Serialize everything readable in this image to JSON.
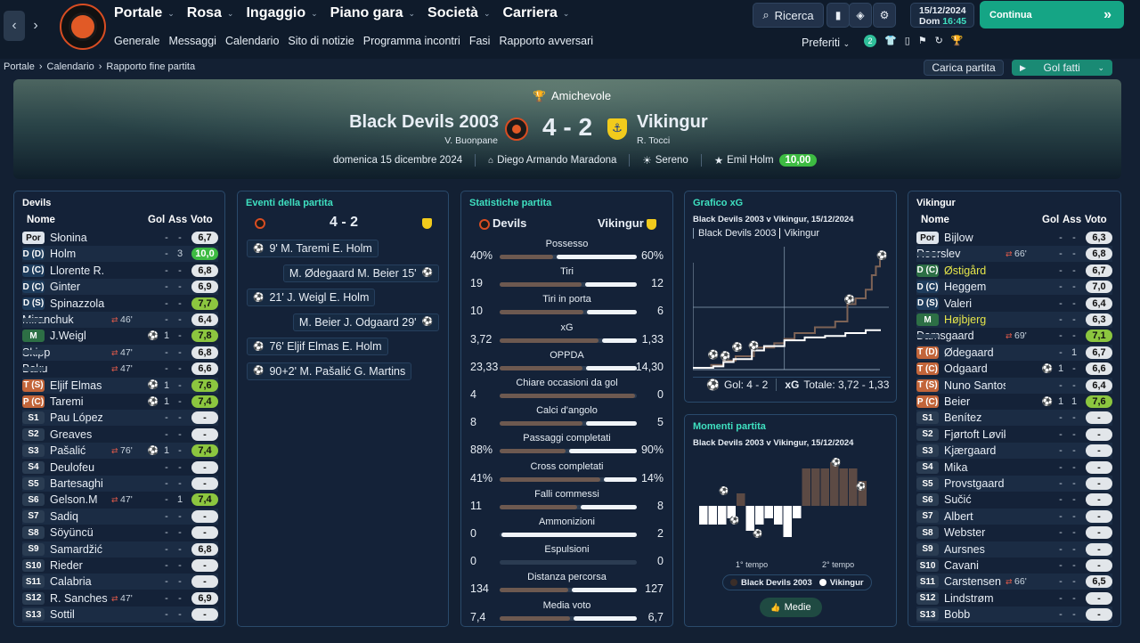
{
  "topbar": {
    "nav": [
      {
        "label": "Portale",
        "active": true
      },
      {
        "label": "Rosa",
        "active": false
      },
      {
        "label": "Ingaggio",
        "active": false
      },
      {
        "label": "Piano gara",
        "active": false
      },
      {
        "label": "Società",
        "active": false
      },
      {
        "label": "Carriera",
        "active": false
      }
    ],
    "subnav": [
      "Generale",
      "Messaggi",
      "Calendario",
      "Sito di notizie",
      "Programma incontri",
      "Fasi",
      "Rapporto avversari"
    ],
    "search_label": "Ricerca",
    "date": "15/12/2024",
    "day": "Dom",
    "time": "16:45",
    "continue_label": "Continua",
    "favorites_label": "Preferiti",
    "notification_count": "2"
  },
  "breadcrumb": [
    "Portale",
    "Calendario",
    "Rapporto fine partita"
  ],
  "actions": {
    "load_match": "Carica partita",
    "goals_filter": "Gol fatti"
  },
  "match": {
    "competition": "Amichevole",
    "home_team": "Black Devils 2003",
    "home_manager": "V. Buonpane",
    "away_team": "Vikingur",
    "away_manager": "R. Tocci",
    "score": "4 - 2",
    "date": "domenica 15 dicembre 2024",
    "stadium": "Diego Armando Maradona",
    "weather": "Sereno",
    "pom_name": "Emil Holm",
    "pom_rating": "10,00"
  },
  "home_lineup": {
    "title": "Devils",
    "headers": {
      "name": "Nome",
      "goals": "Gol",
      "assists": "Ass",
      "rating": "Voto"
    },
    "players": [
      {
        "pos": "Por",
        "type": "gk",
        "name": "Słonina",
        "sub": "",
        "ev": "",
        "g": "-",
        "a": "-",
        "r": "6,7",
        "rc": "r-g"
      },
      {
        "pos": "D (D)",
        "type": "d",
        "name": "Holm",
        "sub": "",
        "ev": "",
        "g": "-",
        "a": "3",
        "r": "10,0",
        "rc": "r-gr"
      },
      {
        "pos": "D (C)",
        "type": "d",
        "name": "Llorente R.",
        "sub": "",
        "ev": "",
        "g": "-",
        "a": "-",
        "r": "6,8",
        "rc": "r-g"
      },
      {
        "pos": "D (C)",
        "type": "d",
        "name": "Ginter",
        "sub": "",
        "ev": "",
        "g": "-",
        "a": "-",
        "r": "6,9",
        "rc": "r-g"
      },
      {
        "pos": "D (S)",
        "type": "d",
        "name": "Spinazzola",
        "sub": "",
        "ev": "",
        "g": "-",
        "a": "-",
        "r": "7,7",
        "rc": "r-lg"
      },
      {
        "pos": "",
        "type": "bar",
        "name": "Miranchuk",
        "sub": "46'",
        "ev": "",
        "g": "-",
        "a": "-",
        "r": "6,4",
        "rc": "r-g"
      },
      {
        "pos": "M",
        "type": "m",
        "name": "J.Weigl",
        "sub": "",
        "ev": "⚽",
        "g": "1",
        "a": "-",
        "r": "7,8",
        "rc": "r-lg"
      },
      {
        "pos": "",
        "type": "bar",
        "name": "Skipp",
        "sub": "47'",
        "ev": "",
        "g": "-",
        "a": "-",
        "r": "6,8",
        "rc": "r-g"
      },
      {
        "pos": "",
        "type": "bar",
        "name": "Baku",
        "sub": "47'",
        "ev": "",
        "g": "-",
        "a": "-",
        "r": "6,6",
        "rc": "r-g"
      },
      {
        "pos": "T (S)",
        "type": "a",
        "name": "Eljif Elmas",
        "sub": "",
        "ev": "⚽",
        "g": "1",
        "a": "-",
        "r": "7,6",
        "rc": "r-lg"
      },
      {
        "pos": "P (C)",
        "type": "a",
        "name": "Taremi",
        "sub": "",
        "ev": "⚽",
        "g": "1",
        "a": "-",
        "r": "7,4",
        "rc": "r-lg"
      },
      {
        "pos": "S1",
        "type": "s",
        "name": "Pau López",
        "sub": "",
        "ev": "",
        "g": "-",
        "a": "-",
        "r": "-",
        "rc": "r-d"
      },
      {
        "pos": "S2",
        "type": "s",
        "name": "Greaves",
        "sub": "",
        "ev": "",
        "g": "-",
        "a": "-",
        "r": "-",
        "rc": "r-d"
      },
      {
        "pos": "S3",
        "type": "s",
        "name": "Pašalić",
        "sub": "76'",
        "ev": "⚽",
        "g": "1",
        "a": "-",
        "r": "7,4",
        "rc": "r-lg"
      },
      {
        "pos": "S4",
        "type": "s",
        "name": "Deulofeu",
        "sub": "",
        "ev": "",
        "g": "-",
        "a": "-",
        "r": "-",
        "rc": "r-d"
      },
      {
        "pos": "S5",
        "type": "s",
        "name": "Bartesaghi",
        "sub": "",
        "ev": "",
        "g": "-",
        "a": "-",
        "r": "-",
        "rc": "r-d"
      },
      {
        "pos": "S6",
        "type": "s",
        "name": "Gelson.M",
        "sub": "47'",
        "ev": "",
        "g": "-",
        "a": "1",
        "r": "7,4",
        "rc": "r-lg"
      },
      {
        "pos": "S7",
        "type": "s",
        "name": "Sadiq",
        "sub": "",
        "ev": "",
        "g": "-",
        "a": "-",
        "r": "-",
        "rc": "r-d"
      },
      {
        "pos": "S8",
        "type": "s",
        "name": "Söyüncü",
        "sub": "",
        "ev": "",
        "g": "-",
        "a": "-",
        "r": "-",
        "rc": "r-d"
      },
      {
        "pos": "S9",
        "type": "s",
        "name": "Samardžić",
        "sub": "",
        "ev": "",
        "g": "-",
        "a": "-",
        "r": "6,8",
        "rc": "r-g"
      },
      {
        "pos": "S10",
        "type": "s",
        "name": "Rieder",
        "sub": "",
        "ev": "",
        "g": "-",
        "a": "-",
        "r": "-",
        "rc": "r-d"
      },
      {
        "pos": "S11",
        "type": "s",
        "name": "Calabria",
        "sub": "",
        "ev": "",
        "g": "-",
        "a": "-",
        "r": "-",
        "rc": "r-d"
      },
      {
        "pos": "S12",
        "type": "s",
        "name": "R. Sanches",
        "sub": "47'",
        "ev": "",
        "g": "-",
        "a": "-",
        "r": "6,9",
        "rc": "r-g"
      },
      {
        "pos": "S13",
        "type": "s",
        "name": "Sottil",
        "sub": "",
        "ev": "",
        "g": "-",
        "a": "-",
        "r": "-",
        "rc": "r-d"
      }
    ]
  },
  "away_lineup": {
    "title": "Vikingur",
    "headers": {
      "name": "Nome",
      "goals": "Gol",
      "assists": "Ass",
      "rating": "Voto"
    },
    "players": [
      {
        "pos": "Por",
        "type": "gk",
        "name": "Bijlow",
        "sub": "",
        "ev": "",
        "g": "-",
        "a": "-",
        "r": "6,3",
        "rc": "r-g"
      },
      {
        "pos": "",
        "type": "bar",
        "name": "Roerslev",
        "sub": "66'",
        "ev": "",
        "g": "-",
        "a": "-",
        "r": "6,8",
        "rc": "r-g"
      },
      {
        "pos": "D (C)",
        "type": "m",
        "name": "Østigård",
        "sub": "",
        "ev": "",
        "g": "-",
        "a": "-",
        "r": "6,7",
        "rc": "r-g",
        "yel": true
      },
      {
        "pos": "D (C)",
        "type": "d",
        "name": "Heggem",
        "sub": "",
        "ev": "",
        "g": "-",
        "a": "-",
        "r": "7,0",
        "rc": "r-g"
      },
      {
        "pos": "D (S)",
        "type": "d",
        "name": "Valeri",
        "sub": "",
        "ev": "",
        "g": "-",
        "a": "-",
        "r": "6,4",
        "rc": "r-g"
      },
      {
        "pos": "M",
        "type": "m",
        "name": "Højbjerg",
        "sub": "",
        "ev": "",
        "g": "-",
        "a": "-",
        "r": "6,3",
        "rc": "r-g",
        "yel": true
      },
      {
        "pos": "",
        "type": "bar",
        "name": "Damsgaard",
        "sub": "69'",
        "ev": "",
        "g": "-",
        "a": "-",
        "r": "7,1",
        "rc": "r-lg"
      },
      {
        "pos": "T (D)",
        "type": "a",
        "name": "Ødegaard",
        "sub": "",
        "ev": "",
        "g": "-",
        "a": "1",
        "r": "6,7",
        "rc": "r-g"
      },
      {
        "pos": "T (C)",
        "type": "a",
        "name": "Odgaard",
        "sub": "",
        "ev": "⚽",
        "g": "1",
        "a": "-",
        "r": "6,6",
        "rc": "r-g"
      },
      {
        "pos": "T (S)",
        "type": "a",
        "name": "Nuno Santos",
        "sub": "",
        "ev": "",
        "g": "-",
        "a": "-",
        "r": "6,4",
        "rc": "r-g"
      },
      {
        "pos": "P (C)",
        "type": "a",
        "name": "Beier",
        "sub": "",
        "ev": "⚽",
        "g": "1",
        "a": "1",
        "r": "7,6",
        "rc": "r-lg"
      },
      {
        "pos": "S1",
        "type": "s",
        "name": "Benítez",
        "sub": "",
        "ev": "",
        "g": "-",
        "a": "-",
        "r": "-",
        "rc": "r-d"
      },
      {
        "pos": "S2",
        "type": "s",
        "name": "Fjørtoft Løvik",
        "sub": "",
        "ev": "",
        "g": "-",
        "a": "-",
        "r": "-",
        "rc": "r-d"
      },
      {
        "pos": "S3",
        "type": "s",
        "name": "Kjærgaard",
        "sub": "",
        "ev": "",
        "g": "-",
        "a": "-",
        "r": "-",
        "rc": "r-d"
      },
      {
        "pos": "S4",
        "type": "s",
        "name": "Mika",
        "sub": "",
        "ev": "",
        "g": "-",
        "a": "-",
        "r": "-",
        "rc": "r-d"
      },
      {
        "pos": "S5",
        "type": "s",
        "name": "Provstgaard",
        "sub": "",
        "ev": "",
        "g": "-",
        "a": "-",
        "r": "-",
        "rc": "r-d"
      },
      {
        "pos": "S6",
        "type": "s",
        "name": "Sučić",
        "sub": "",
        "ev": "",
        "g": "-",
        "a": "-",
        "r": "-",
        "rc": "r-d"
      },
      {
        "pos": "S7",
        "type": "s",
        "name": "Albert",
        "sub": "",
        "ev": "",
        "g": "-",
        "a": "-",
        "r": "-",
        "rc": "r-d"
      },
      {
        "pos": "S8",
        "type": "s",
        "name": "Webster",
        "sub": "",
        "ev": "",
        "g": "-",
        "a": "-",
        "r": "-",
        "rc": "r-d"
      },
      {
        "pos": "S9",
        "type": "s",
        "name": "Aursnes",
        "sub": "",
        "ev": "",
        "g": "-",
        "a": "-",
        "r": "-",
        "rc": "r-d"
      },
      {
        "pos": "S10",
        "type": "s",
        "name": "Cavani",
        "sub": "",
        "ev": "",
        "g": "-",
        "a": "-",
        "r": "-",
        "rc": "r-d"
      },
      {
        "pos": "S11",
        "type": "s",
        "name": "Carstensen",
        "sub": "66'",
        "ev": "",
        "g": "-",
        "a": "-",
        "r": "6,5",
        "rc": "r-g"
      },
      {
        "pos": "S12",
        "type": "s",
        "name": "Lindstrøm",
        "sub": "",
        "ev": "",
        "g": "-",
        "a": "-",
        "r": "-",
        "rc": "r-d"
      },
      {
        "pos": "S13",
        "type": "s",
        "name": "Bobb",
        "sub": "",
        "ev": "",
        "g": "-",
        "a": "-",
        "r": "-",
        "rc": "r-d"
      }
    ]
  },
  "events": {
    "title": "Eventi della partita",
    "score": "4 - 2",
    "items": [
      {
        "side": "home",
        "text": "9' M. Taremi E. Holm"
      },
      {
        "side": "away",
        "text": "M. Ødegaard M. Beier 15'"
      },
      {
        "side": "home",
        "text": "21' J. Weigl E. Holm"
      },
      {
        "side": "away",
        "text": "M. Beier J. Odgaard 29'"
      },
      {
        "side": "home",
        "text": "76' Eljif Elmas E. Holm"
      },
      {
        "side": "home",
        "text": "90+2' M. Pašalić G. Martins"
      }
    ]
  },
  "stats": {
    "title": "Statistiche partita",
    "home": "Devils",
    "away": "Vikingur",
    "rows": [
      {
        "label": "Possesso",
        "h": "40%",
        "a": "60%",
        "hv": 40,
        "av": 60
      },
      {
        "label": "Tiri",
        "h": "19",
        "a": "12",
        "hv": 19,
        "av": 12
      },
      {
        "label": "Tiri in porta",
        "h": "10",
        "a": "6",
        "hv": 10,
        "av": 6
      },
      {
        "label": "xG",
        "h": "3,72",
        "a": "1,33",
        "hv": 3.72,
        "av": 1.33
      },
      {
        "label": "OPPDA",
        "h": "23,33",
        "a": "14,30",
        "hv": 23.33,
        "av": 14.3
      },
      {
        "label": "Chiare occasioni da gol",
        "h": "4",
        "a": "0",
        "hv": 4,
        "av": 0
      },
      {
        "label": "Calci d'angolo",
        "h": "8",
        "a": "5",
        "hv": 8,
        "av": 5
      },
      {
        "label": "Passaggi completati",
        "h": "88%",
        "a": "90%",
        "hv": 88,
        "av": 90
      },
      {
        "label": "Cross completati",
        "h": "41%",
        "a": "14%",
        "hv": 41,
        "av": 14
      },
      {
        "label": "Falli commessi",
        "h": "11",
        "a": "8",
        "hv": 11,
        "av": 8
      },
      {
        "label": "Ammonizioni",
        "h": "0",
        "a": "2",
        "hv": 0,
        "av": 2
      },
      {
        "label": "Espulsioni",
        "h": "0",
        "a": "0",
        "hv": 0,
        "av": 0
      },
      {
        "label": "Distanza percorsa",
        "h": "134",
        "a": "127",
        "hv": 134,
        "av": 127
      },
      {
        "label": "Media voto",
        "h": "7,4",
        "a": "6,7",
        "hv": 7.4,
        "av": 6.7
      }
    ]
  },
  "xg_panel": {
    "title": "Grafico xG",
    "subtitle": "Black Devils 2003 v Vikingur, 15/12/2024",
    "legend_home": "Black Devils 2003",
    "legend_away": "Vikingur",
    "goals_label": "Gol: 4 - 2",
    "xg_total_label": "xG",
    "xg_total": "Totale: 3,72 - 1,33"
  },
  "momentum_panel": {
    "title": "Momenti partita",
    "subtitle": "Black Devils 2003 v Vikingur, 15/12/2024",
    "first_half": "1° tempo",
    "second_half": "2° tempo",
    "legend_home": "Black Devils 2003",
    "legend_away": "Vikingur",
    "medie_label": "Medie"
  },
  "chart_data": [
    {
      "type": "line",
      "title": "Grafico xG",
      "series": [
        {
          "name": "Black Devils 2003",
          "x": [
            0,
            9,
            15,
            21,
            30,
            40,
            45,
            50,
            60,
            70,
            76,
            80,
            85,
            88,
            90,
            92
          ],
          "y": [
            0,
            0.1,
            0.25,
            0.4,
            0.7,
            0.85,
            1.0,
            1.2,
            1.4,
            1.6,
            2.2,
            2.4,
            2.7,
            3.2,
            3.5,
            3.72
          ]
        },
        {
          "name": "Vikingur",
          "x": [
            0,
            10,
            15,
            20,
            29,
            35,
            45,
            55,
            65,
            75,
            85,
            92
          ],
          "y": [
            0,
            0.05,
            0.2,
            0.3,
            0.6,
            0.75,
            0.95,
            1.05,
            1.1,
            1.2,
            1.3,
            1.33
          ]
        }
      ],
      "ylim": [
        0,
        4
      ],
      "xlim": [
        0,
        92
      ]
    },
    {
      "type": "bar",
      "title": "Momenti partita",
      "series": [
        {
          "name": "Black Devils 2003",
          "values": [
            -3,
            -1,
            -2,
            0,
            0,
            -4,
            0,
            -2,
            -3,
            -5,
            0,
            6,
            6,
            6,
            7,
            6,
            6,
            4
          ]
        },
        {
          "name": "Vikingur",
          "values": [
            0,
            -3,
            -3,
            -2,
            2,
            0,
            -3,
            0,
            0,
            0,
            -2,
            0,
            0,
            0,
            0,
            0,
            0,
            0
          ]
        }
      ]
    }
  ]
}
